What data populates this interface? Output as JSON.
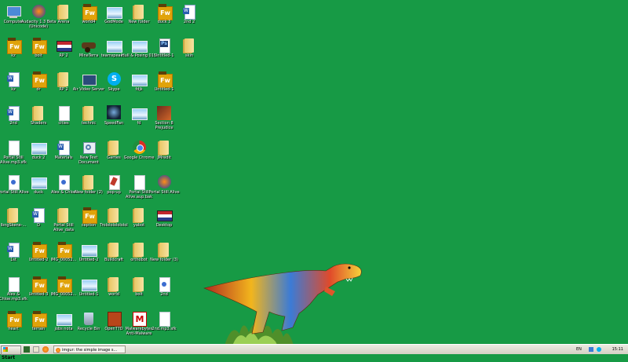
{
  "desktop": {
    "background_color": "#179a45",
    "icons": [
      {
        "label": "Computer",
        "type": "computer",
        "col": 0,
        "row": 0
      },
      {
        "label": "Audacity 1.3 Beta (Unicode)",
        "type": "audacity",
        "col": 1,
        "row": 0
      },
      {
        "label": "Arena",
        "type": "folder",
        "col": 2,
        "row": 0
      },
      {
        "label": "world4",
        "type": "fw",
        "col": 3,
        "row": 0
      },
      {
        "label": "GodMode",
        "type": "image",
        "col": 4,
        "row": 0
      },
      {
        "label": "New folder",
        "type": "folder",
        "col": 5,
        "row": 0
      },
      {
        "label": "duck 3",
        "type": "fw",
        "col": 6,
        "row": 0
      },
      {
        "label": "2nd 2",
        "type": "word",
        "col": 7,
        "row": 0
      },
      {
        "label": "kz",
        "type": "fw",
        "col": 0,
        "row": 1
      },
      {
        "label": "bolt",
        "type": "fw",
        "col": 1,
        "row": 1
      },
      {
        "label": "RP 2",
        "type": "flag",
        "col": 2,
        "row": 1
      },
      {
        "label": "MineTerra",
        "type": "cannon",
        "col": 3,
        "row": 1
      },
      {
        "label": "teamspeak...",
        "type": "image",
        "col": 4,
        "row": 1
      },
      {
        "label": "Hull & Posing 015",
        "type": "image",
        "col": 5,
        "row": 1
      },
      {
        "label": "Untitled-1",
        "type": "ps",
        "col": 6,
        "row": 1
      },
      {
        "label": "skin",
        "type": "folder",
        "col": 7,
        "row": 1
      },
      {
        "label": "kz",
        "type": "word",
        "col": 0,
        "row": 2
      },
      {
        "label": "dr",
        "type": "fw",
        "col": 1,
        "row": 2
      },
      {
        "label": "RP 2",
        "type": "folder",
        "col": 2,
        "row": 2
      },
      {
        "label": "Air Video Server",
        "type": "tv",
        "col": 3,
        "row": 2
      },
      {
        "label": "Skype",
        "type": "skype",
        "col": 4,
        "row": 2
      },
      {
        "label": "fdjk",
        "type": "image",
        "col": 5,
        "row": 2
      },
      {
        "label": "Untitled-1",
        "type": "fw",
        "col": 6,
        "row": 2
      },
      {
        "label": "2nd",
        "type": "word",
        "col": 0,
        "row": 3
      },
      {
        "label": "Shaders",
        "type": "folder",
        "col": 1,
        "row": 3
      },
      {
        "label": "cities",
        "type": "doc",
        "col": 2,
        "row": 3
      },
      {
        "label": "technic",
        "type": "folder",
        "col": 3,
        "row": 3
      },
      {
        "label": "SpeedFan",
        "type": "speedfan",
        "col": 4,
        "row": 3
      },
      {
        "label": "fd",
        "type": "image",
        "col": 5,
        "row": 3
      },
      {
        "label": "Section 8 Prejudice",
        "type": "game",
        "col": 6,
        "row": 3
      },
      {
        "label": "Portal Still Alive.mp3.sfk",
        "type": "doc",
        "col": 0,
        "row": 4
      },
      {
        "label": "duck 2",
        "type": "image",
        "col": 1,
        "row": 4
      },
      {
        "label": "Materials",
        "type": "word",
        "col": 2,
        "row": 4
      },
      {
        "label": "New Text Document",
        "type": "gear",
        "col": 3,
        "row": 4
      },
      {
        "label": "Games",
        "type": "folder",
        "col": 4,
        "row": 4
      },
      {
        "label": "Google Chrome",
        "type": "chrome",
        "col": 5,
        "row": 4
      },
      {
        "label": "JMredit",
        "type": "folder",
        "col": 6,
        "row": 4
      },
      {
        "label": "Portal Still Alive",
        "type": "mp3",
        "col": 0,
        "row": 5
      },
      {
        "label": "duck",
        "type": "image",
        "col": 1,
        "row": 5
      },
      {
        "label": "Alex & Chloe",
        "type": "mp3",
        "col": 2,
        "row": 5
      },
      {
        "label": "New folder (2)",
        "type": "folder",
        "col": 3,
        "row": 5
      },
      {
        "label": "pop-up",
        "type": "script",
        "col": 4,
        "row": 5
      },
      {
        "label": "Portal Still Alive.aup.bak",
        "type": "doc",
        "col": 5,
        "row": 5
      },
      {
        "label": "Portal Still Alive",
        "type": "audacity",
        "col": 6,
        "row": 5
      },
      {
        "label": "lbngSkene-...",
        "type": "folder",
        "col": 0,
        "row": 6
      },
      {
        "label": "D",
        "type": "word",
        "col": 1,
        "row": 6
      },
      {
        "label": "Portal Still Alive_data",
        "type": "folder",
        "col": 2,
        "row": 6
      },
      {
        "label": "ception",
        "type": "fw",
        "col": 3,
        "row": 6
      },
      {
        "label": "Trololololololol",
        "type": "folder",
        "col": 4,
        "row": 6
      },
      {
        "label": "yabot",
        "type": "folder",
        "col": 5,
        "row": 6
      },
      {
        "label": "Desktop",
        "type": "flag",
        "col": 6,
        "row": 6
      },
      {
        "label": "1st",
        "type": "word",
        "col": 0,
        "row": 7
      },
      {
        "label": "Untitled-2",
        "type": "fw",
        "col": 1,
        "row": 7
      },
      {
        "label": "IMG_00052...",
        "type": "fw",
        "col": 2,
        "row": 7
      },
      {
        "label": "Untitled-2",
        "type": "image",
        "col": 3,
        "row": 7
      },
      {
        "label": "Buildcraft",
        "type": "folder",
        "col": 4,
        "row": 7
      },
      {
        "label": "orthobot",
        "type": "folder",
        "col": 5,
        "row": 7
      },
      {
        "label": "New folder (3)",
        "type": "folder",
        "col": 6,
        "row": 7
      },
      {
        "label": "Alex & Chloe.mp3.sfk",
        "type": "doc",
        "col": 0,
        "row": 8
      },
      {
        "label": "Untitled-3",
        "type": "fw",
        "col": 1,
        "row": 8
      },
      {
        "label": "IMG_00052...",
        "type": "fw",
        "col": 2,
        "row": 8
      },
      {
        "label": "Untitled-1",
        "type": "image",
        "col": 3,
        "row": 8
      },
      {
        "label": "world",
        "type": "folder",
        "col": 4,
        "row": 8
      },
      {
        "label": "bolt",
        "type": "folder",
        "col": 5,
        "row": 8
      },
      {
        "label": "2nd",
        "type": "mp3",
        "col": 6,
        "row": 8
      },
      {
        "label": "heart",
        "type": "fw",
        "col": 0,
        "row": 9
      },
      {
        "label": "terrain",
        "type": "fw",
        "col": 1,
        "row": 9
      },
      {
        "label": "jobs nota",
        "type": "image",
        "col": 2,
        "row": 9
      },
      {
        "label": "Recycle Bin",
        "type": "recycle",
        "col": 3,
        "row": 9
      },
      {
        "label": "OpenTTD",
        "type": "openttd",
        "col": 4,
        "row": 9
      },
      {
        "label": "Malwarebytes Anti-Malware",
        "type": "mbam",
        "col": 5,
        "row": 9
      },
      {
        "label": "2nd.mp3.sfk",
        "type": "doc",
        "col": 6,
        "row": 9
      }
    ]
  },
  "taskbar": {
    "start_label": "Start",
    "task_button_label": "imgur: the simple image s...",
    "language": "EN",
    "clock": "15:11"
  },
  "icon_glyph_text": {
    "fw": "Fw",
    "ps": "Ps",
    "word": "W",
    "skype": "S",
    "mbam": "M"
  }
}
